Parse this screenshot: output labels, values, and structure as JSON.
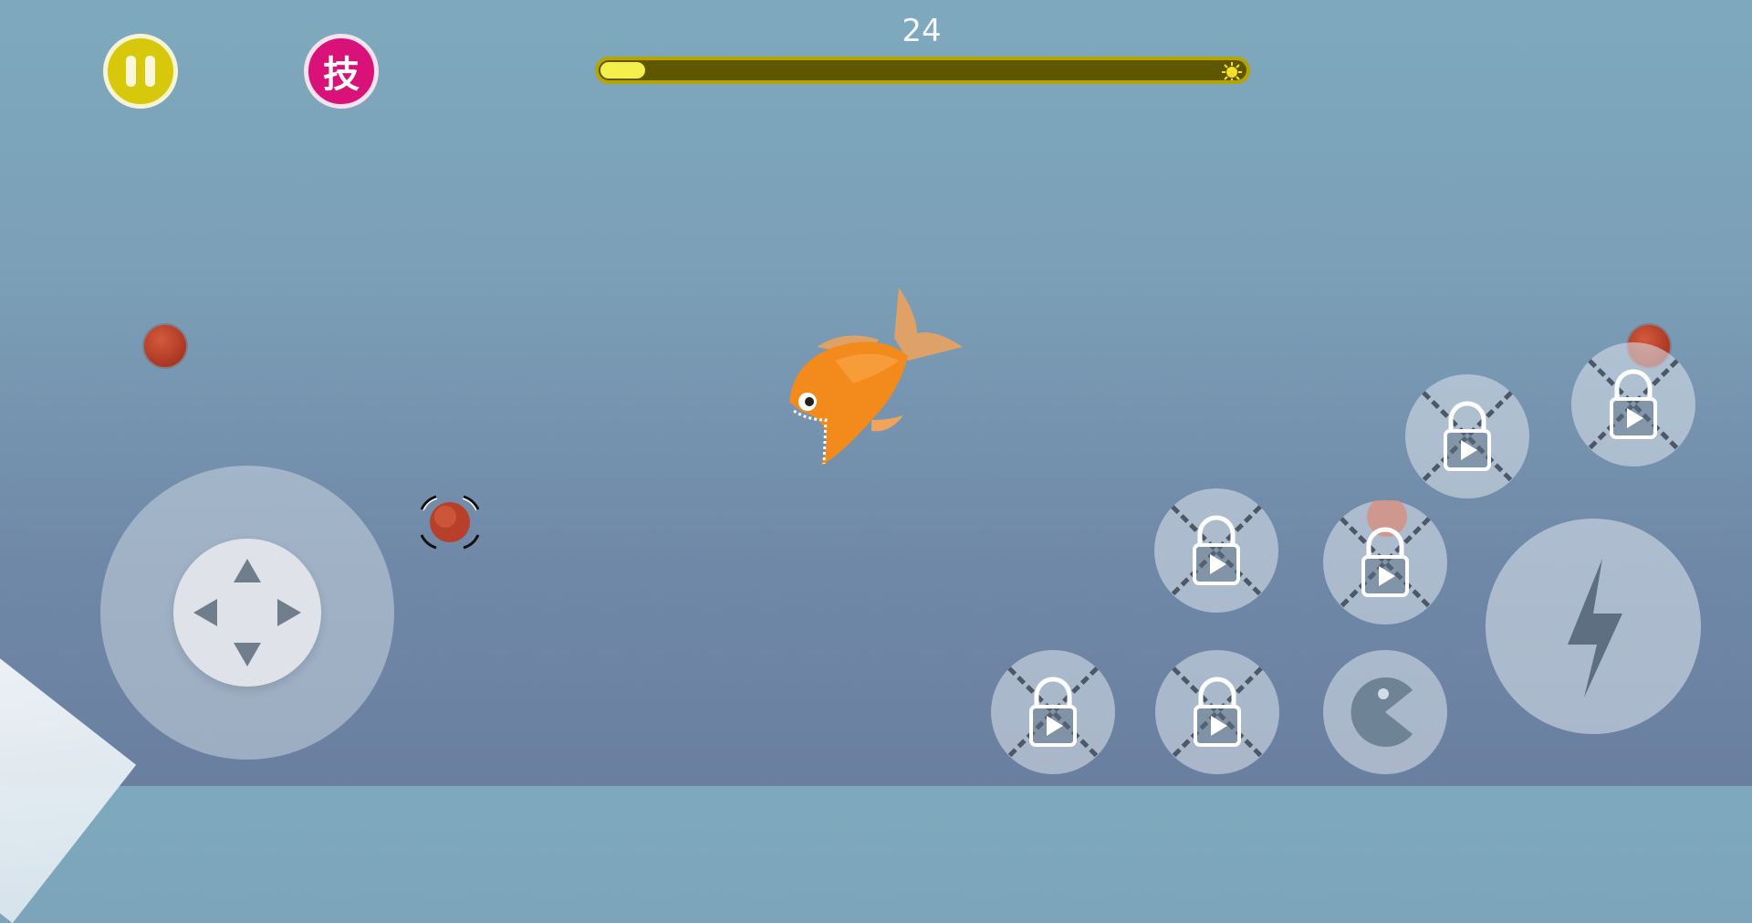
{
  "hud": {
    "score": "24",
    "skill_button_label": "技",
    "progress_fraction": 0.07,
    "colors": {
      "pause": "#d8c80c",
      "skill": "#d9127a",
      "bar_track": "#5f5700",
      "bar_fill": "#f3ef4c"
    }
  },
  "player": {
    "icon": "orange-piranha"
  },
  "controls": {
    "joystick": {
      "icon": "dpad-arrows"
    },
    "dash": {
      "icon": "lightning-bolt-icon"
    },
    "eat": {
      "icon": "pacman-icon"
    },
    "locked_slots": [
      {
        "name": "locked-skill-1",
        "state": "locked"
      },
      {
        "name": "locked-skill-2",
        "state": "locked"
      },
      {
        "name": "locked-skill-3",
        "state": "locked"
      },
      {
        "name": "locked-skill-4",
        "state": "locked"
      },
      {
        "name": "locked-skill-5",
        "state": "locked"
      },
      {
        "name": "locked-skill-6",
        "state": "locked"
      }
    ]
  }
}
